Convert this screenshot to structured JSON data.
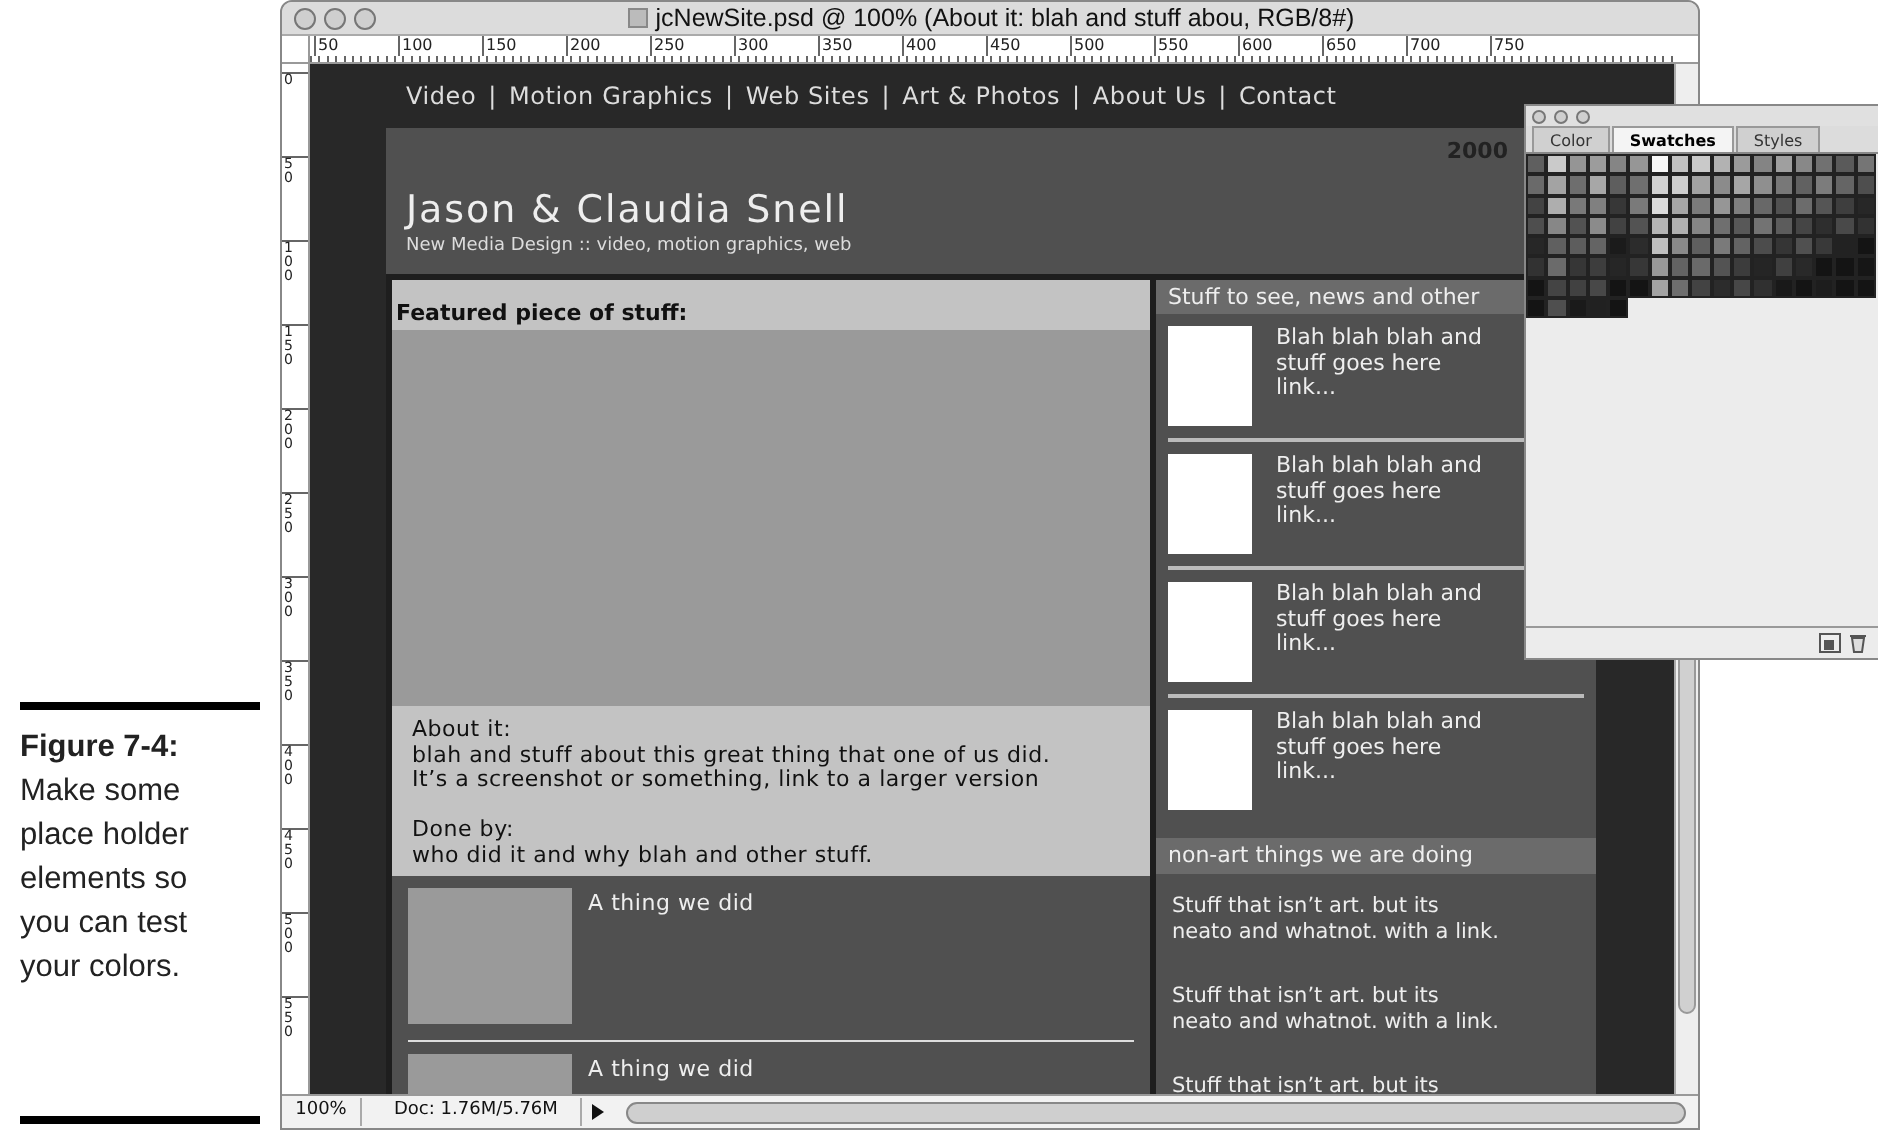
{
  "caption": {
    "label": "Figure 7-4:",
    "text": "Make some place holder elements so you can test your colors."
  },
  "window": {
    "title": "jcNewSite.psd @ 100% (About it:  blah and stuff abou, RGB/8#)"
  },
  "top_ruler": [
    "50",
    "100",
    "150",
    "200",
    "250",
    "300",
    "350",
    "400",
    "450",
    "500",
    "550",
    "600",
    "650",
    "700",
    "750"
  ],
  "left_ruler": [
    "0",
    "50",
    "100",
    "150",
    "200",
    "250",
    "300",
    "350",
    "400",
    "450",
    "500",
    "550"
  ],
  "site": {
    "nav": [
      "Video",
      "Motion Graphics",
      "Web Sites",
      "Art & Photos",
      "About Us",
      "Contact"
    ],
    "nav_separator": "|",
    "year": "2000",
    "title": "Jason & Claudia Snell",
    "tagline": "New Media Design :: video, motion graphics, web",
    "featured": {
      "heading": "Featured piece of stuff:",
      "about": "About it:\nblah and stuff about this great thing that one of us did.\nIt’s a screenshot or something, link to a larger version\n\nDone by:\nwho did it and why blah and other stuff."
    },
    "things": [
      "A thing we did",
      "A thing we did"
    ],
    "news": {
      "heading": "Stuff to see, news and other",
      "items": [
        "Blah blah blah and\nstuff goes here\nlink...",
        "Blah blah blah and\nstuff goes here\nlink...",
        "Blah blah blah and\nstuff goes here\nlink...",
        "Blah blah blah and\nstuff goes here\nlink..."
      ]
    },
    "nonart": {
      "heading": "non-art things we are doing",
      "items": [
        "Stuff that isn’t art. but its\nneato and whatnot. with a link.",
        "Stuff that isn’t art. but its\nneato and whatnot. with a link.",
        "Stuff that isn’t art. but its"
      ]
    }
  },
  "status_bar": {
    "zoom": "100%",
    "doc": "Doc: 1.76M/5.76M"
  },
  "swatches_panel": {
    "tabs": [
      {
        "label": "Color",
        "selected": false
      },
      {
        "label": "Swatches",
        "selected": true
      },
      {
        "label": "Styles",
        "selected": false
      }
    ]
  }
}
